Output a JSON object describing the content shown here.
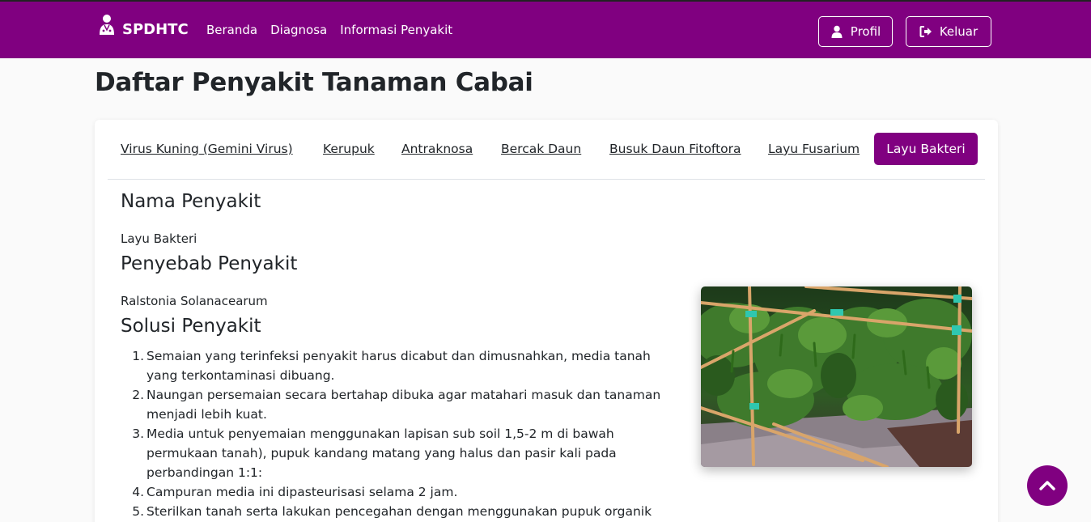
{
  "navbar": {
    "brand": "SPDHTC",
    "links": [
      "Beranda",
      "Diagnosa",
      "Informasi Penyakit"
    ],
    "profile_label": "Profil",
    "logout_label": "Keluar",
    "bg_color": "#800080"
  },
  "page": {
    "title": "Daftar Penyakit Tanaman Cabai"
  },
  "tabs": [
    {
      "label": "Virus Kuning (Gemini Virus)",
      "active": false
    },
    {
      "label": "Kerupuk",
      "active": false
    },
    {
      "label": "Antraknosa",
      "active": false
    },
    {
      "label": "Bercak Daun",
      "active": false
    },
    {
      "label": "Busuk Daun Fitoftora",
      "active": false
    },
    {
      "label": "Layu Fusarium",
      "active": false
    },
    {
      "label": "Layu Bakteri",
      "active": true
    }
  ],
  "disease": {
    "name_heading": "Nama Penyakit",
    "name": "Layu Bakteri",
    "cause_heading": "Penyebab Penyakit",
    "cause": "Ralstonia Solanacearum",
    "solution_heading": "Solusi Penyakit",
    "solutions": [
      "Semaian yang terinfeksi penyakit harus dicabut dan dimusnahkan, media tanah yang terkontaminasi dibuang.",
      "Naungan persemaian secara bertahap dibuka agar matahari masuk dan tanaman menjadi lebih kuat.",
      "Media untuk penyemaian menggunakan lapisan sub soil 1,5-2 m di bawah permukaan tanah), pupuk kandang matang yang halus dan pasir kali pada perbandingan 1:1:",
      "Campuran media ini dipasteurisasi selama 2 jam.",
      "Sterilkan tanah serta lakukan pencegahan dengan menggunakan pupuk organik"
    ]
  },
  "icons": {
    "brand": "doctor-icon",
    "profile": "user-icon",
    "logout": "sign-out-icon",
    "scroll_top": "chevron-up-icon"
  }
}
